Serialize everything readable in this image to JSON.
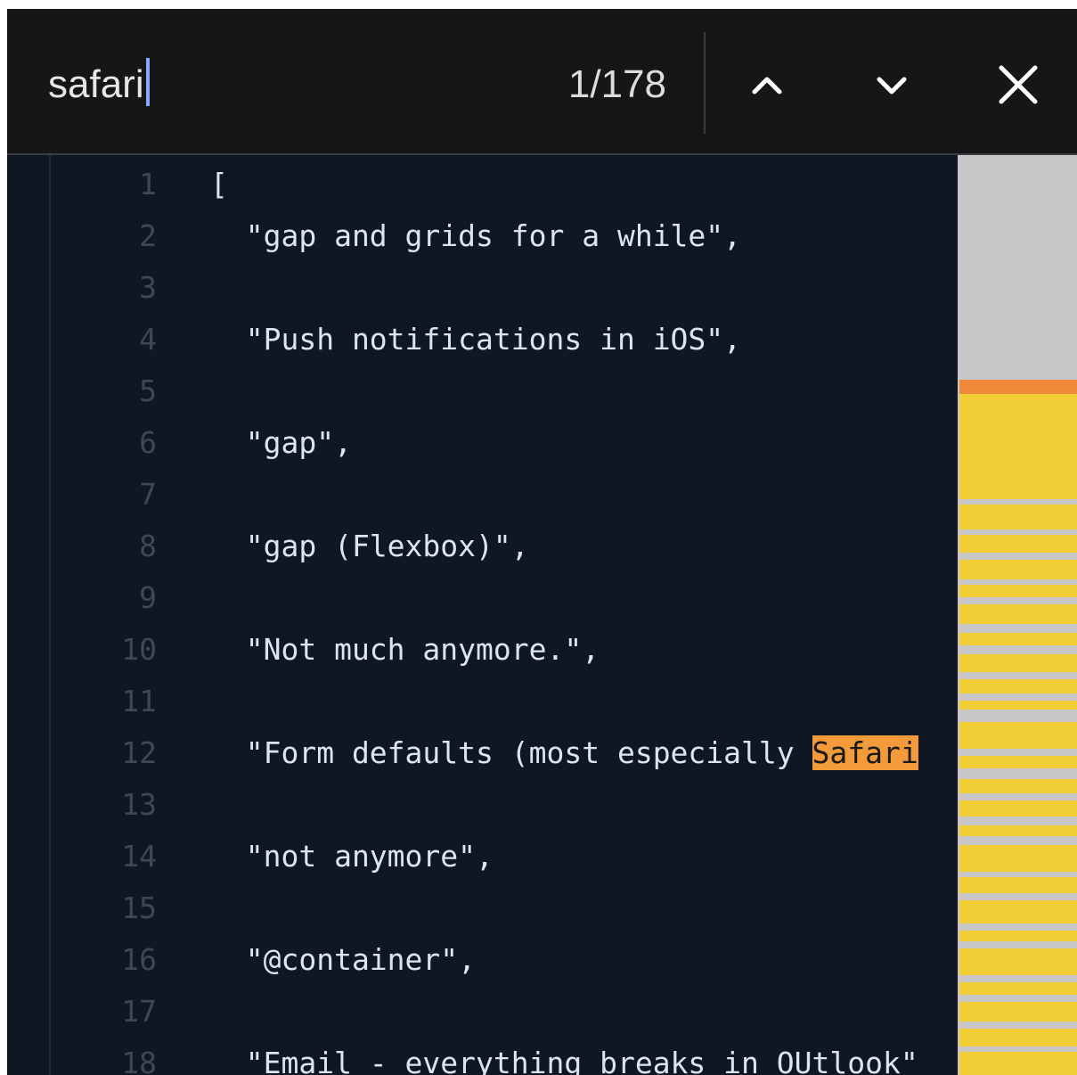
{
  "find_bar": {
    "query": "safari",
    "match_count": "1/178",
    "prev_icon": "chevron-up-icon",
    "next_icon": "chevron-down-icon",
    "close_icon": "close-icon"
  },
  "editor": {
    "lines": [
      {
        "n": "1",
        "text": "["
      },
      {
        "n": "2",
        "text": "  \"gap and grids for a while\","
      },
      {
        "n": "3",
        "text": ""
      },
      {
        "n": "4",
        "text": "  \"Push notifications in iOS\","
      },
      {
        "n": "5",
        "text": ""
      },
      {
        "n": "6",
        "text": "  \"gap\","
      },
      {
        "n": "7",
        "text": ""
      },
      {
        "n": "8",
        "text": "  \"gap (Flexbox)\","
      },
      {
        "n": "9",
        "text": ""
      },
      {
        "n": "10",
        "text": "  \"Not much anymore.\","
      },
      {
        "n": "11",
        "text": ""
      },
      {
        "n": "12",
        "text": "  \"Form defaults (most especially ",
        "match": "Safari"
      },
      {
        "n": "13",
        "text": ""
      },
      {
        "n": "14",
        "text": "  \"not anymore\","
      },
      {
        "n": "15",
        "text": ""
      },
      {
        "n": "16",
        "text": "  \"@container\","
      },
      {
        "n": "17",
        "text": ""
      },
      {
        "n": "18",
        "text": "  \"Email - everything breaks in OUtlook\""
      }
    ]
  },
  "colors": {
    "find_bar_bg": "#161616",
    "editor_bg": "#101722",
    "current_match": "#f39a3a",
    "other_matches": "#f2cf36",
    "minimap_bg": "#c8c8c8"
  }
}
